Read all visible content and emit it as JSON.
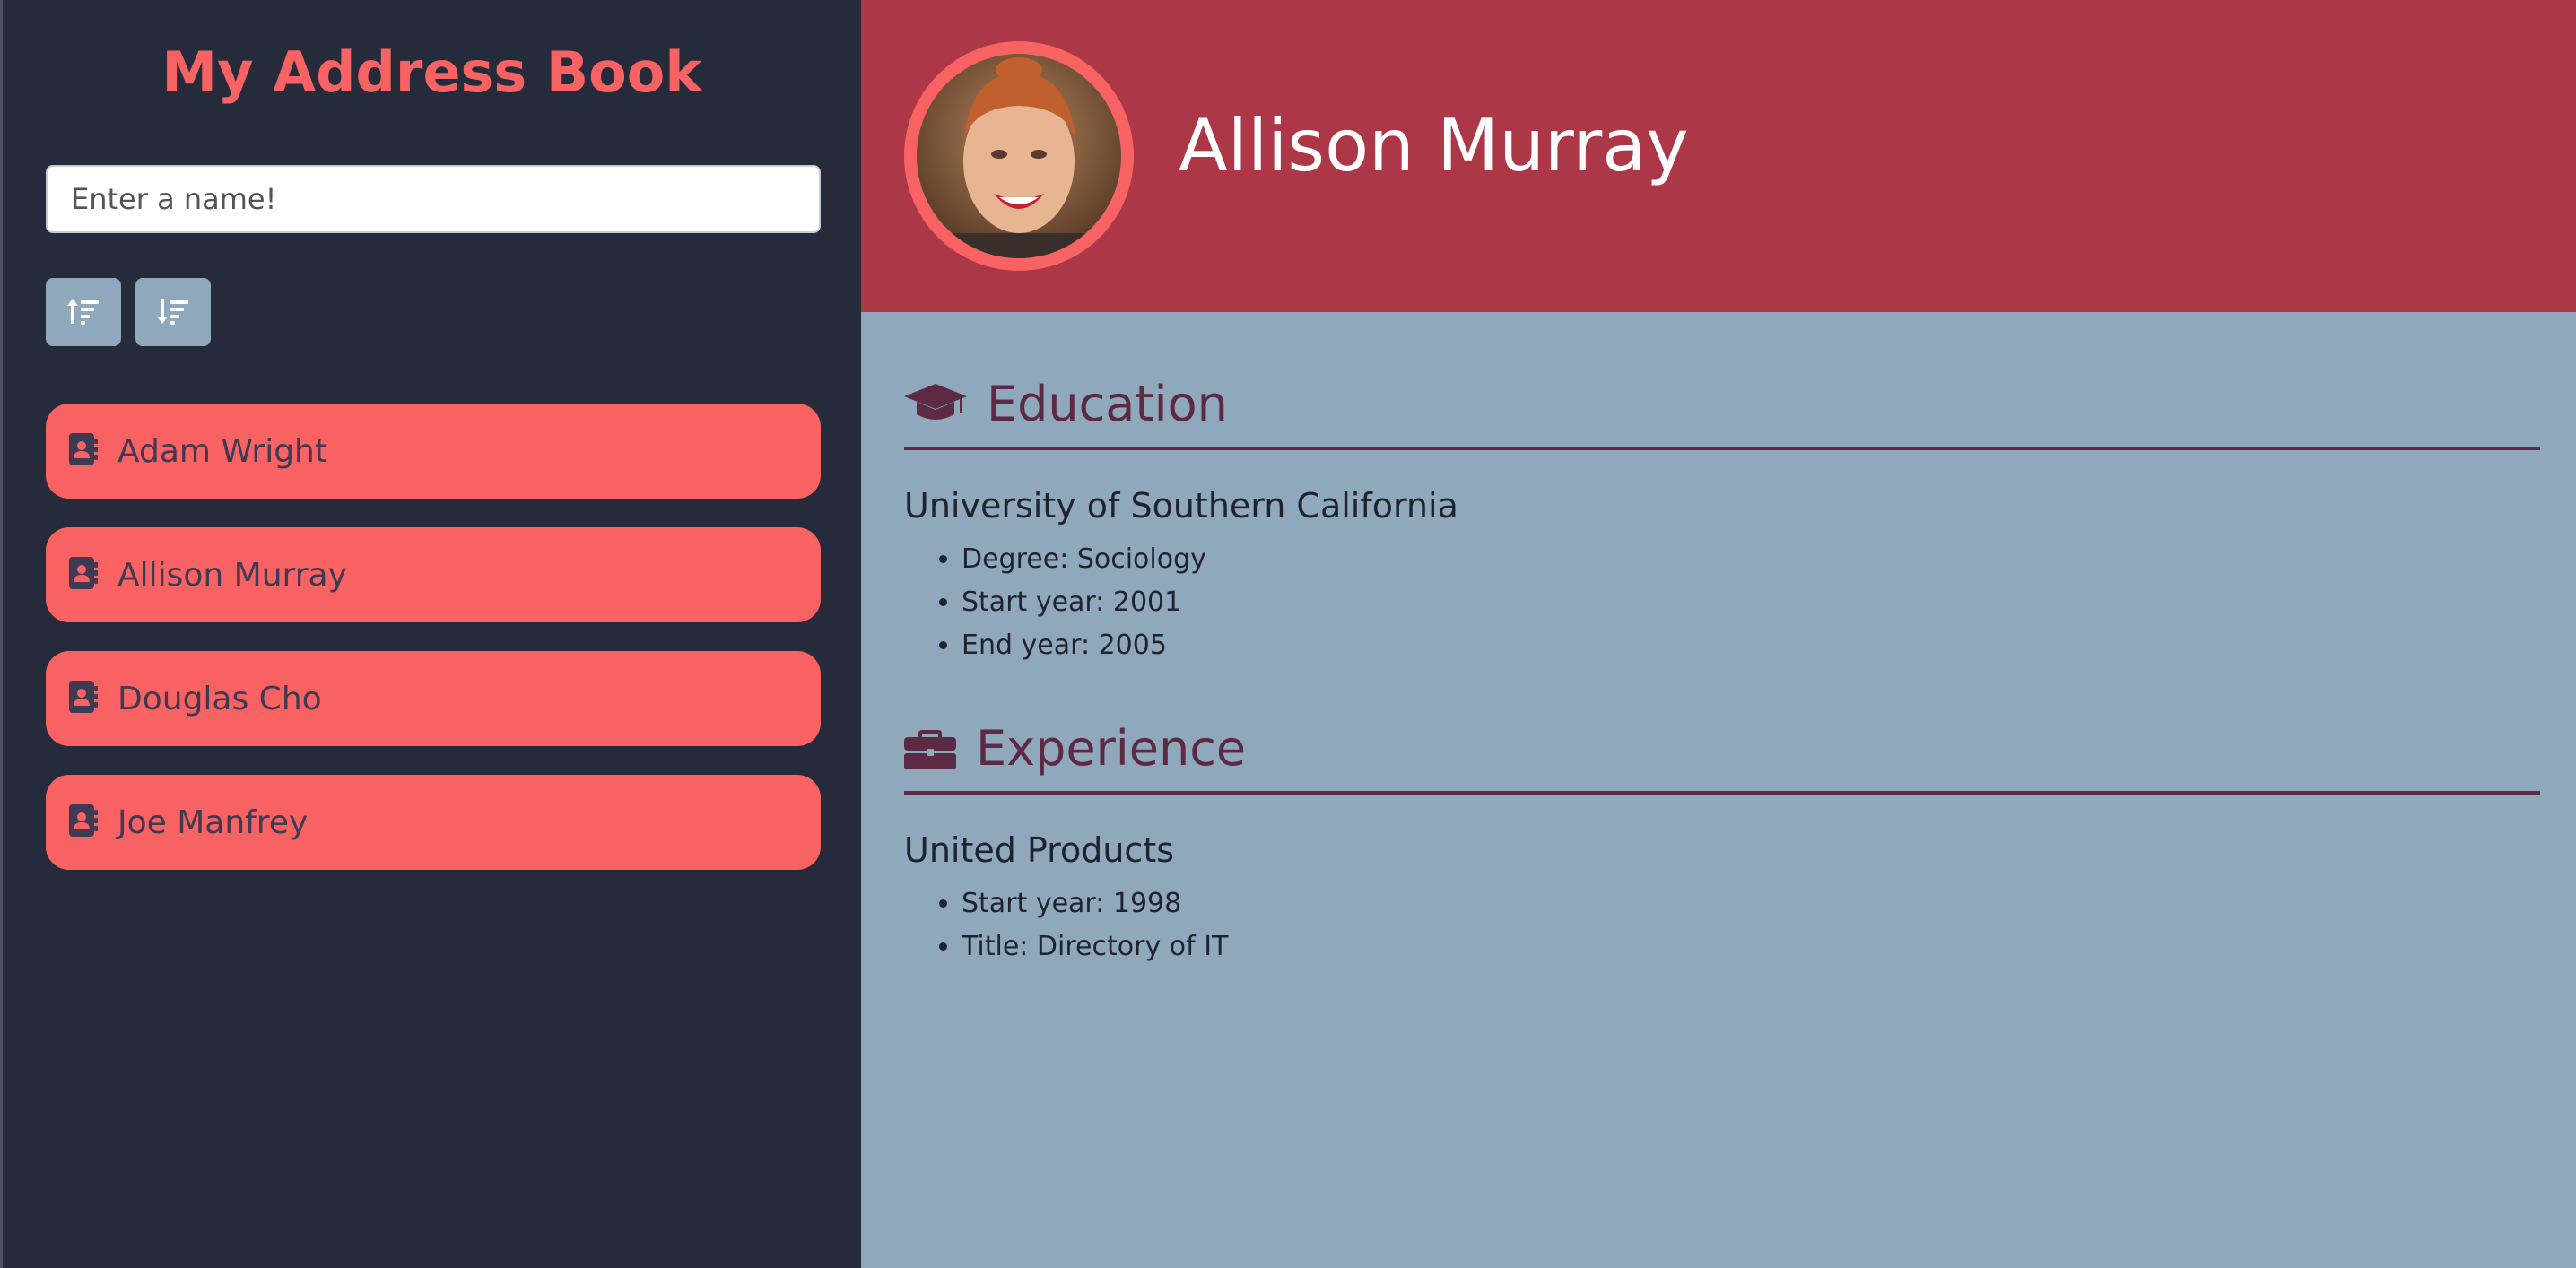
{
  "app": {
    "title": "My Address Book"
  },
  "search": {
    "placeholder": "Enter a name!"
  },
  "sort": {
    "ascending_icon": "sort-ascending-icon",
    "descending_icon": "sort-descending-icon"
  },
  "contacts": [
    {
      "name": "Adam Wright",
      "icon": "address-card-icon"
    },
    {
      "name": "Allison Murray",
      "icon": "address-card-icon"
    },
    {
      "name": "Douglas Cho",
      "icon": "address-card-icon"
    },
    {
      "name": "Joe Manfrey",
      "icon": "address-card-icon"
    }
  ],
  "profile": {
    "name": "Allison Murray",
    "education": {
      "heading": "Education",
      "icon": "graduation-cap-icon",
      "school": "University of Southern California",
      "details": [
        "Degree: Sociology",
        "Start year: 2001",
        "End year: 2005"
      ]
    },
    "experience": {
      "heading": "Experience",
      "icon": "briefcase-icon",
      "company": "United Products",
      "details": [
        "Start year: 1998",
        "Title: Directory of IT"
      ]
    }
  },
  "colors": {
    "sidebar_bg": "#252b3a",
    "accent": "#f96262",
    "header_bg": "#ab3747",
    "main_bg": "#8fa8bc",
    "heading_text": "#5c2a42"
  }
}
